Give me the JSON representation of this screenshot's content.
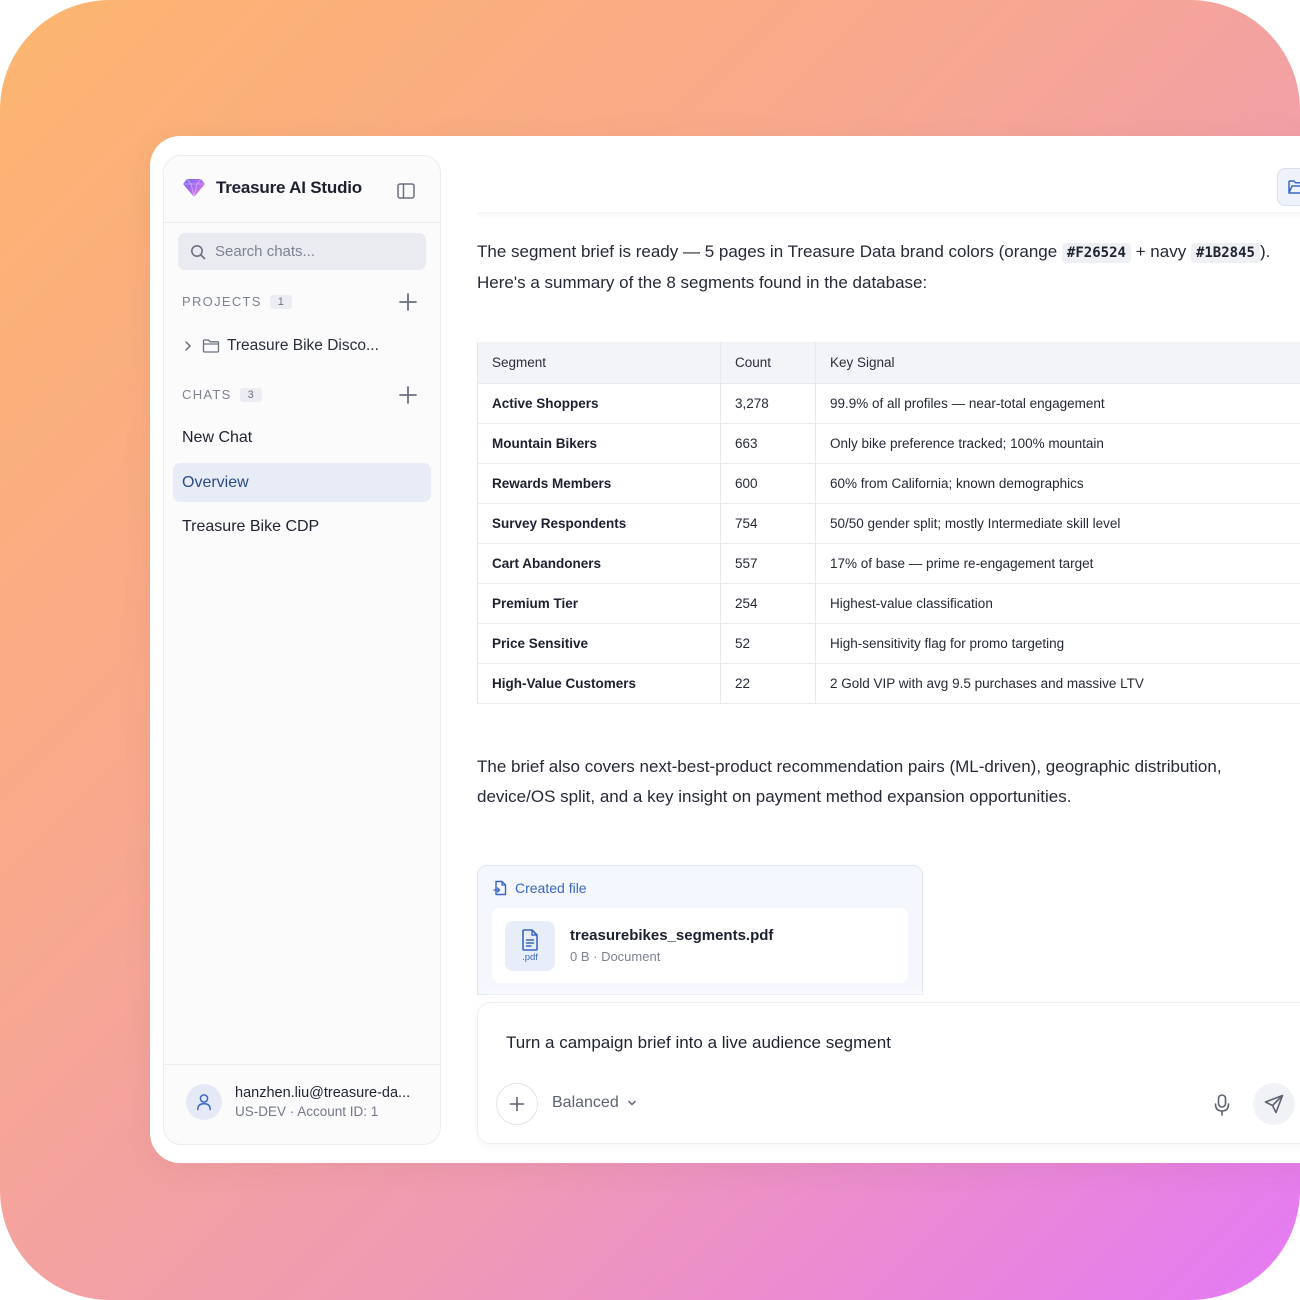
{
  "app": {
    "name": "Treasure AI Studio"
  },
  "search": {
    "placeholder": "Search chats..."
  },
  "sidebar": {
    "projects": {
      "label": "PROJECTS",
      "count": "1",
      "items": [
        {
          "label": "Treasure Bike Disco..."
        }
      ]
    },
    "chats": {
      "label": "CHATS",
      "count": "3",
      "items": [
        {
          "label": "New Chat",
          "active": false
        },
        {
          "label": "Overview",
          "active": true
        },
        {
          "label": "Treasure Bike CDP",
          "active": false
        }
      ]
    },
    "user": {
      "email": "hanzhen.liu@treasure-da...",
      "sub": "US-DEV · Account ID: 1"
    }
  },
  "message": {
    "intro_1": "The segment brief is ready — 5 pages in Treasure Data brand colors (orange ",
    "orange_code": "#F26524",
    "intro_2": " + navy ",
    "navy_code": "#1B2845",
    "intro_3": ").",
    "intro_4": "Here's a summary of the 8 segments found in the database:",
    "table": {
      "headers": [
        "Segment",
        "Count",
        "Key Signal"
      ],
      "rows": [
        [
          "Active Shoppers",
          "3,278",
          "99.9% of all profiles — near-total engagement"
        ],
        [
          "Mountain Bikers",
          "663",
          "Only bike preference tracked; 100% mountain"
        ],
        [
          "Rewards Members",
          "600",
          "60% from California; known demographics"
        ],
        [
          "Survey Respondents",
          "754",
          "50/50 gender split; mostly Intermediate skill level"
        ],
        [
          "Cart Abandoners",
          "557",
          "17% of base — prime re-engagement target"
        ],
        [
          "Premium Tier",
          "254",
          "Highest-value classification"
        ],
        [
          "Price Sensitive",
          "52",
          "High-sensitivity flag for promo targeting"
        ],
        [
          "High-Value Customers",
          "22",
          "2 Gold VIP with avg 9.5 purchases and massive LTV"
        ]
      ]
    },
    "outro": "The brief also covers next-best-product recommendation pairs (ML-driven), geographic distribution, device/OS split, and a key insight on payment method expansion opportunities.",
    "file": {
      "header": "Created file",
      "name": "treasurebikes_segments.pdf",
      "meta": "0 B · Document",
      "ext": ".pdf"
    }
  },
  "composer": {
    "value": "Turn a campaign brief into a live audience segment",
    "mode": "Balanced"
  },
  "colors": {
    "accent": "#3a67c4",
    "active_bg": "#e8ecf7",
    "active_text": "#2b4b86"
  }
}
